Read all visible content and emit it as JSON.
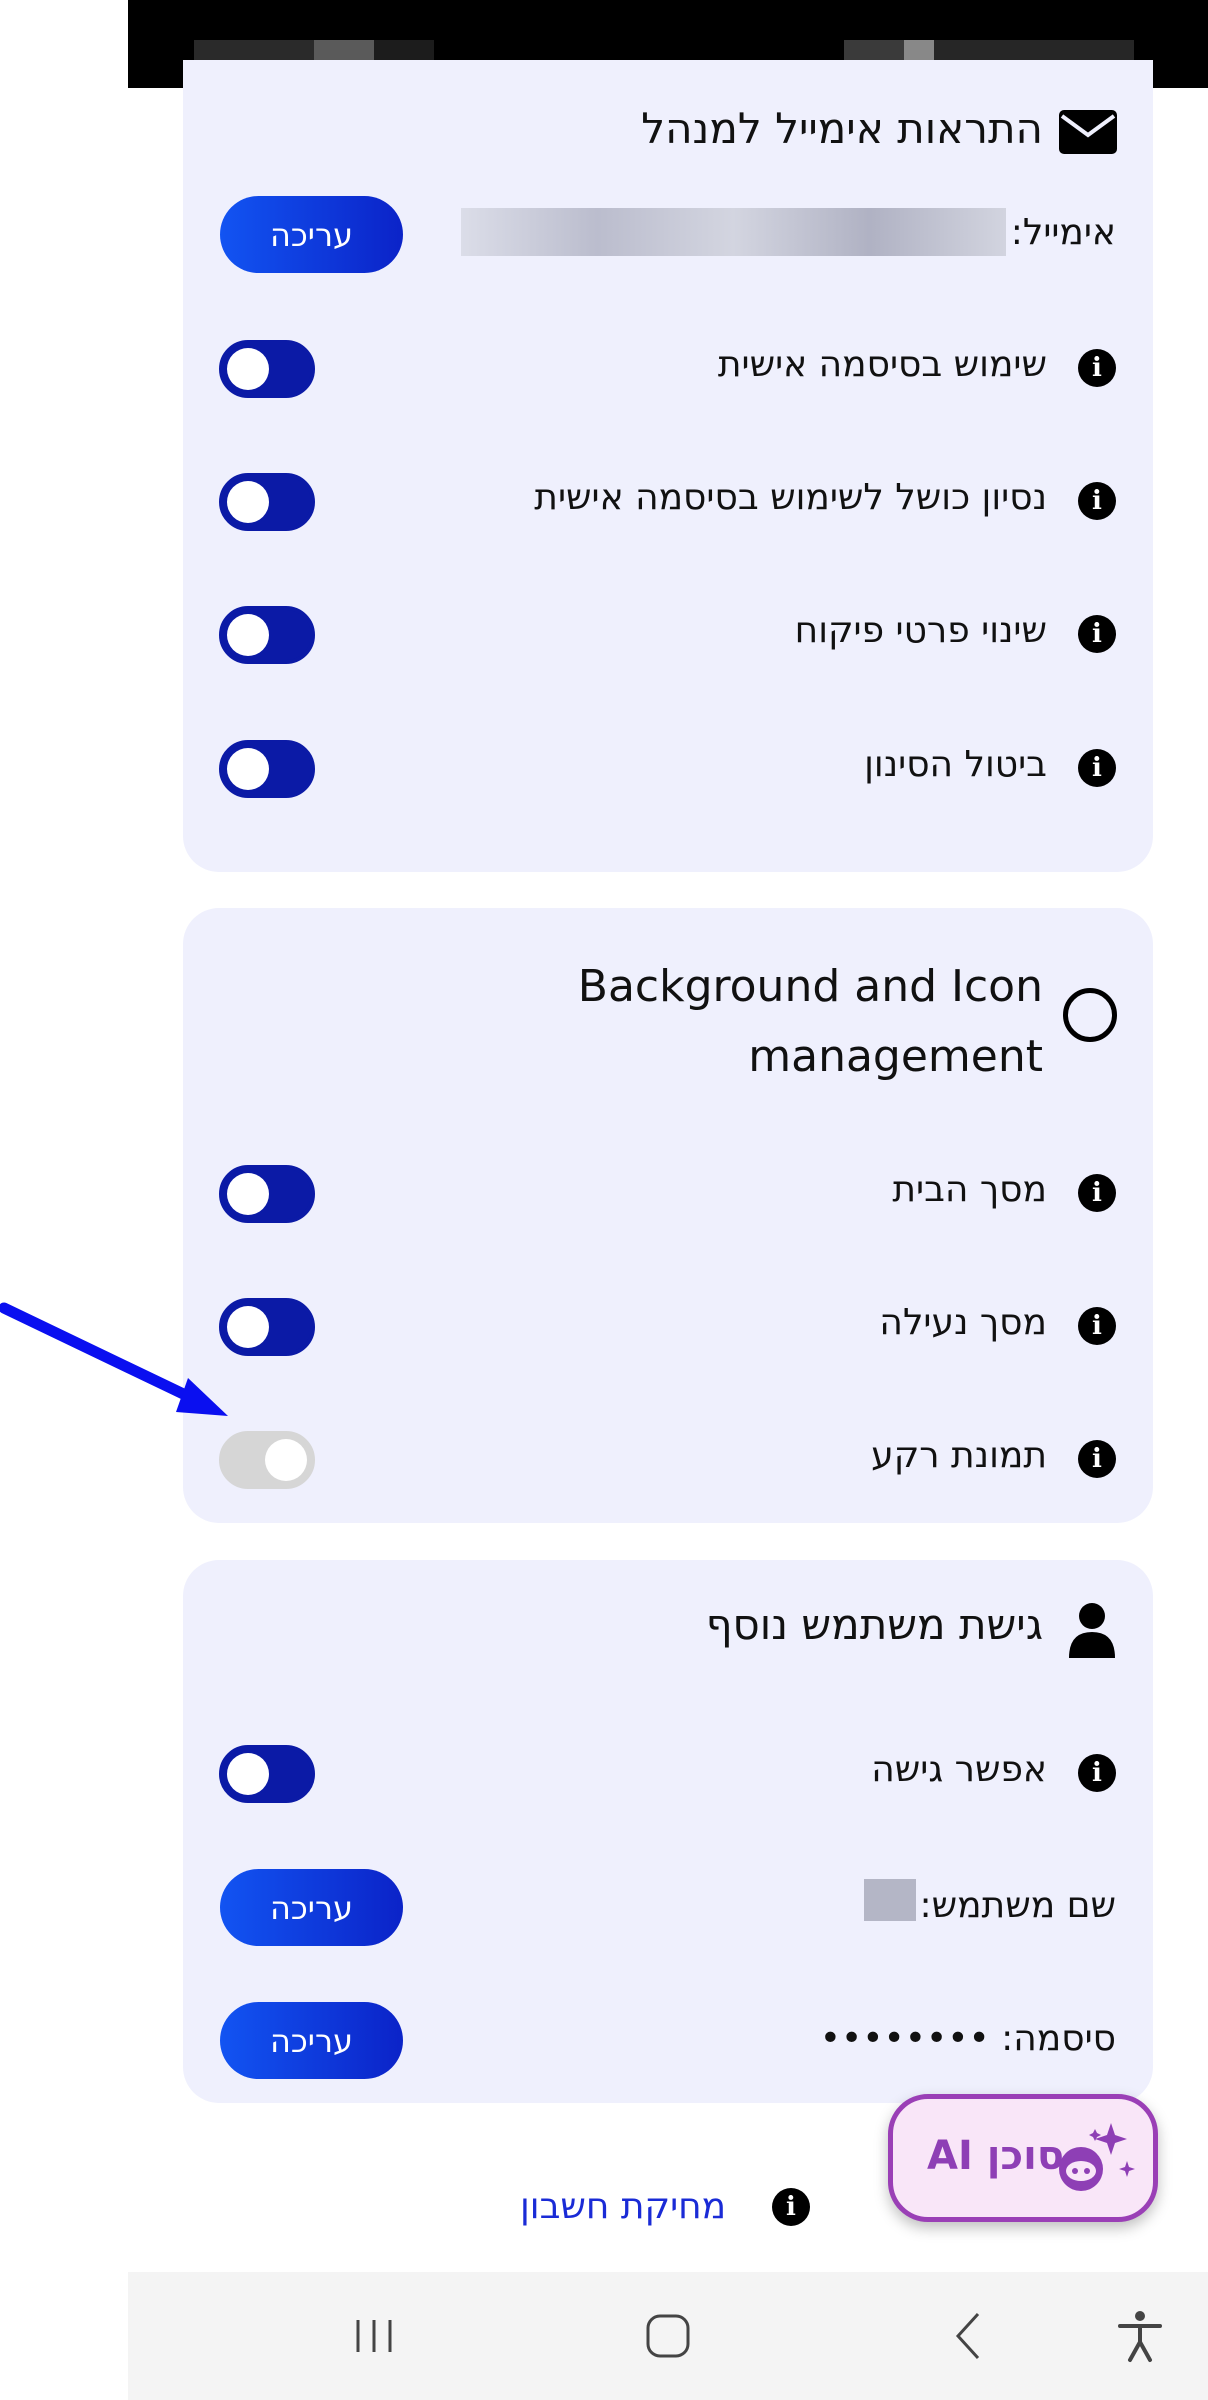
{
  "admin_email_section": {
    "title": "התראות אימייל למנהל",
    "email_label": "אימייל:",
    "edit_label": "עריכה",
    "toggles": [
      {
        "label": "שימוש בסיסמה אישית",
        "on": true
      },
      {
        "label": "נסיון כושל לשימוש בסיסמה אישית",
        "on": true
      },
      {
        "label": "שינוי פרטי פיקוח",
        "on": true
      },
      {
        "label": "ביטול הסינון",
        "on": true
      }
    ]
  },
  "background_section": {
    "title_line1": "Background and Icon",
    "title_line2": "management",
    "toggles": [
      {
        "label": "מסך הבית",
        "on": true
      },
      {
        "label": "מסך נעילה",
        "on": true
      },
      {
        "label": "תמונת רקע",
        "on": false
      }
    ]
  },
  "extra_user_section": {
    "title": "גישת משתמש נוסף",
    "toggle": {
      "label": "אפשר גישה",
      "on": true
    },
    "username_label": "שם משתמש:",
    "password_label": "סיסמה: ••••••••",
    "edit_label": "עריכה"
  },
  "delete_account_label": "מחיקת חשבון",
  "ai_agent": {
    "label": "סוכן AI"
  },
  "colors": {
    "accent": "#0b1aa6",
    "card_bg": "#eff0fd",
    "ai_purple": "#8e3fb5"
  }
}
